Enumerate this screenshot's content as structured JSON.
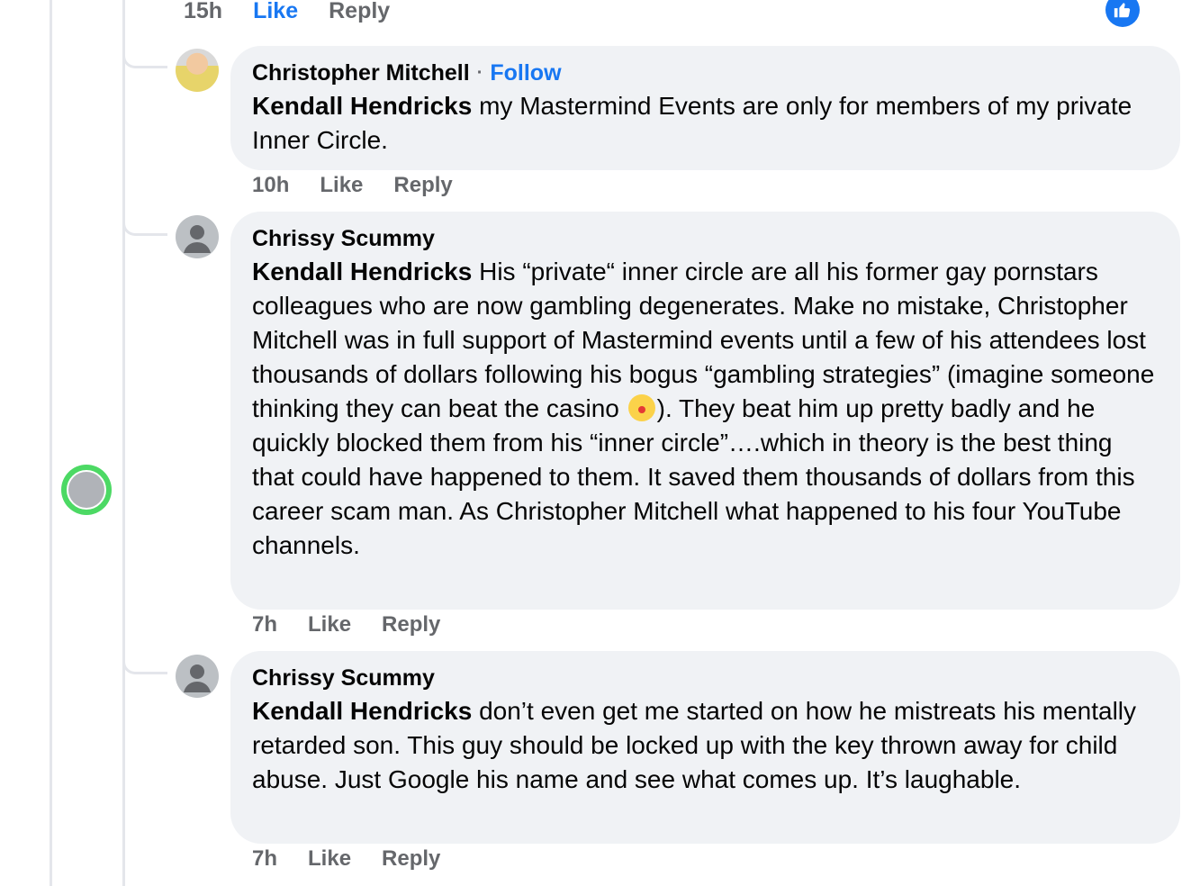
{
  "top_actions": {
    "time": "15h",
    "like": "Like",
    "reply": "Reply"
  },
  "comments": [
    {
      "author": "Christopher Mitchell",
      "follow": "Follow",
      "mention": "Kendall Hendricks",
      "text": "my Mastermind Events are only for members of my private Inner Circle.",
      "time": "10h",
      "like": "Like",
      "reply": "Reply",
      "avatar": "photo"
    },
    {
      "author": "Chrissy Scummy",
      "mention": "Kendall Hendricks",
      "text_before_emoji": "His “private“ inner circle are all his former gay pornstars colleagues who are now gambling degenerates. Make no mistake, Christopher Mitchell was in full support of Mastermind events until a few of his attendees lost thousands of dollars following his bogus “gambling strategies” (imagine someone thinking they can beat the casino",
      "emoji": "clown-face",
      "text_after_emoji": "). They beat him up pretty badly and he quickly blocked them from his “inner circle”….which in theory is the best thing that could have happened to them. It saved them thousands of dollars from this career scam man. As Christopher Mitchell what happened to his four YouTube channels.",
      "time": "7h",
      "like": "Like",
      "reply": "Reply",
      "avatar": "default"
    },
    {
      "author": "Chrissy Scummy",
      "mention": "Kendall Hendricks",
      "text": "don’t even get me started on how he mistreats his mentally retarded son. This guy should be locked up with the key thrown away for child abuse. Just Google his name and see what comes up. It’s laughable.",
      "time": "7h",
      "like": "Like",
      "reply": "Reply",
      "avatar": "default"
    }
  ],
  "colors": {
    "accent": "#1877f2",
    "bubble": "#f0f2f5",
    "meta": "#65676b",
    "online": "#4cd964"
  }
}
